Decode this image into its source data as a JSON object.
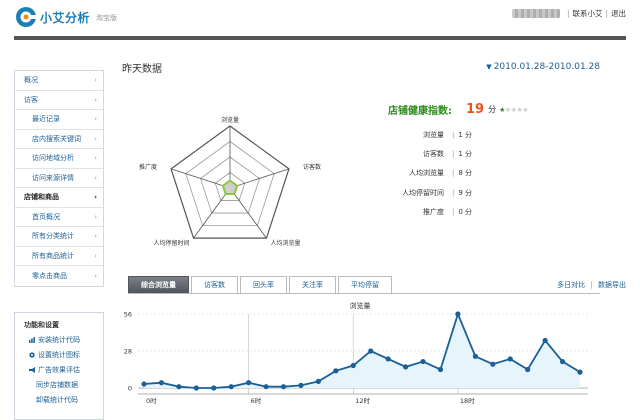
{
  "header": {
    "logo_text": "小艾分析",
    "logo_sub": "淘宝版",
    "contact_link": "联系小艾",
    "logout_link": "退出"
  },
  "sidebar": {
    "items": [
      {
        "label": "概况",
        "level": 0
      },
      {
        "label": "访客",
        "level": 0
      },
      {
        "label": "最近记录",
        "level": 1
      },
      {
        "label": "店内搜索关键词",
        "level": 1
      },
      {
        "label": "访问地域分析",
        "level": 1
      },
      {
        "label": "访问来源详情",
        "level": 1
      },
      {
        "label": "店铺和商品",
        "level": 0,
        "active": true
      },
      {
        "label": "首页概况",
        "level": 1
      },
      {
        "label": "所有分类统计",
        "level": 1
      },
      {
        "label": "所有商品统计",
        "level": 1
      },
      {
        "label": "零点击商品",
        "level": 1
      }
    ]
  },
  "functions": {
    "title": "功能和设置",
    "items": [
      {
        "label": "安装统计代码",
        "icon": "code-icon"
      },
      {
        "label": "设置统计图标",
        "icon": "settings-icon"
      },
      {
        "label": "广告效果评估",
        "icon": "ad-icon"
      },
      {
        "label": "同步店铺数据",
        "icon": ""
      },
      {
        "label": "卸载统计代码",
        "icon": ""
      }
    ]
  },
  "main": {
    "title": "昨天数据",
    "date_range": "2010.01.28-2010.01.28"
  },
  "radar": {
    "axes": [
      "浏览量",
      "访客数",
      "人均浏览量",
      "人均停留时间",
      "推广度"
    ],
    "values": [
      1,
      1,
      8,
      9,
      0
    ],
    "max": 100
  },
  "health": {
    "label": "店铺健康指数:",
    "score": "19",
    "unit": "分",
    "stars_filled": 1,
    "stars_total": 5
  },
  "metrics": [
    {
      "label": "浏览量",
      "value": "1 分"
    },
    {
      "label": "访客数",
      "value": "1 分"
    },
    {
      "label": "人均浏览量",
      "value": "8 分"
    },
    {
      "label": "人均停留时间",
      "value": "9 分"
    },
    {
      "label": "推广度",
      "value": "0 分"
    }
  ],
  "tabs": {
    "items": [
      "综合浏览量",
      "访客数",
      "回头率",
      "关注率",
      "平均停留"
    ],
    "active": 0,
    "links": [
      "多日对比",
      "数据导出"
    ]
  },
  "chart_data": {
    "type": "area",
    "title": "浏览量",
    "x": [
      0,
      1,
      2,
      3,
      4,
      5,
      6,
      7,
      8,
      9,
      10,
      11,
      12,
      13,
      14,
      15,
      16,
      17,
      18,
      19,
      20,
      21,
      22,
      23
    ],
    "values": [
      3,
      4,
      1,
      0,
      0,
      1,
      4,
      1,
      1,
      2,
      5,
      13,
      17,
      28,
      22,
      16,
      20,
      14,
      56,
      24,
      18,
      22,
      14,
      36,
      20,
      12
    ],
    "series": [
      {
        "name": "浏览量",
        "values": [
          3,
          4,
          1,
          0,
          0,
          1,
          4,
          1,
          1,
          2,
          5,
          13,
          17,
          28,
          22,
          16,
          20,
          14,
          56,
          24,
          18,
          22,
          14,
          36,
          20,
          12
        ]
      }
    ],
    "x_ticks": [
      "0时",
      "6时",
      "12时",
      "18时"
    ],
    "y_ticks": [
      0,
      28,
      56
    ],
    "ylim": [
      0,
      56
    ],
    "line_color": "#1a5f96",
    "fill_color": "#e6f4fb",
    "grid": true
  },
  "colors": {
    "accent_blue": "#1a5f96",
    "health_green": "#2e8b1e",
    "score_orange": "#e8541a"
  }
}
